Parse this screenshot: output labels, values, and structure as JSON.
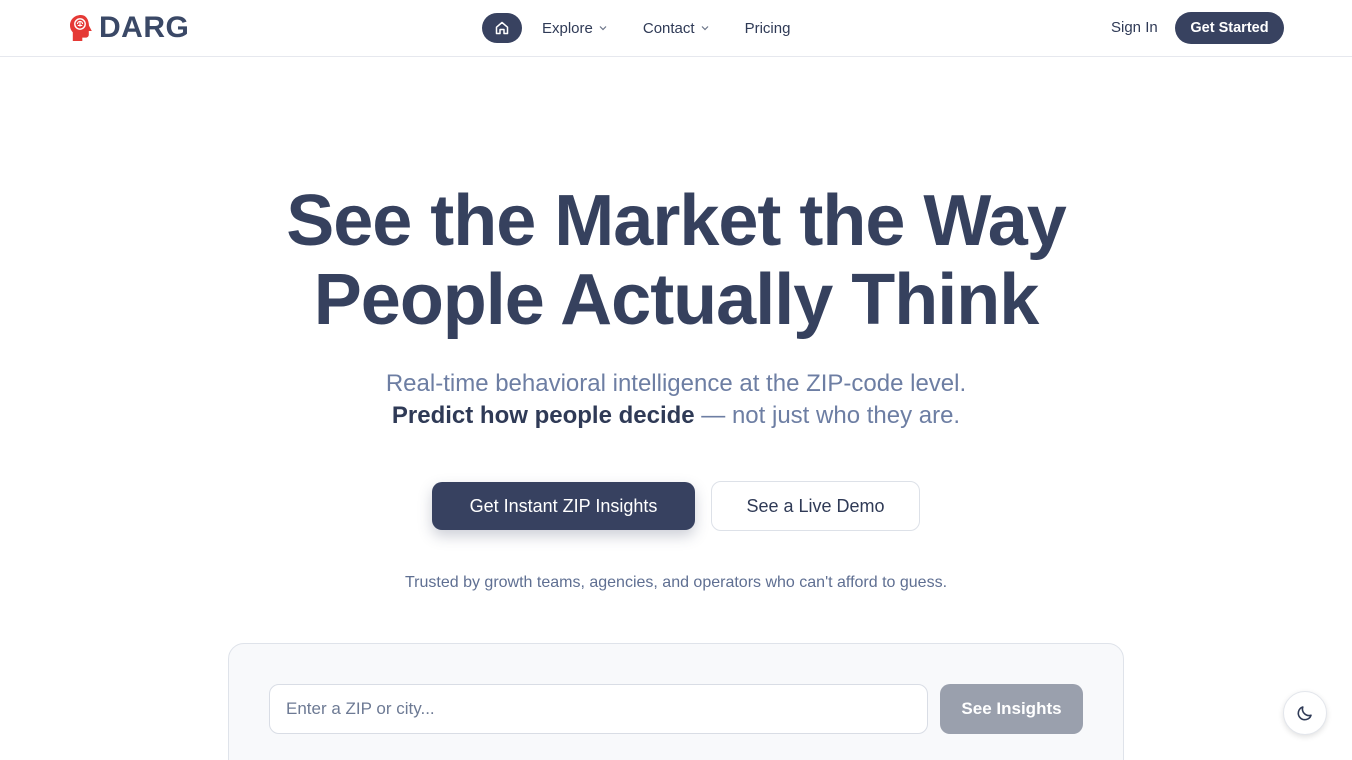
{
  "brand": {
    "name": "DARG",
    "accent": "#e53935"
  },
  "nav": {
    "home_icon": "home-icon",
    "explore": "Explore",
    "contact": "Contact",
    "pricing": "Pricing"
  },
  "auth": {
    "sign_in": "Sign In",
    "get_started": "Get Started"
  },
  "hero": {
    "title_line1": "See the Market the Way",
    "title_line2": "People Actually Think",
    "subtitle_line1": "Real-time behavioral intelligence at the ZIP-code level.",
    "subtitle_strong": "Predict how people decide",
    "subtitle_rest": " — not just who they are.",
    "cta_primary": "Get Instant ZIP Insights",
    "cta_secondary": "See a Live Demo",
    "trusted": "Trusted by growth teams, agencies, and operators who can't afford to guess."
  },
  "search": {
    "placeholder": "Enter a ZIP or city...",
    "value": "",
    "button": "See Insights"
  },
  "theme_toggle": {
    "icon": "moon-icon"
  },
  "colors": {
    "primary": "#374160",
    "muted_button": "#9aa0ad",
    "text_muted": "#6d7ea3"
  }
}
